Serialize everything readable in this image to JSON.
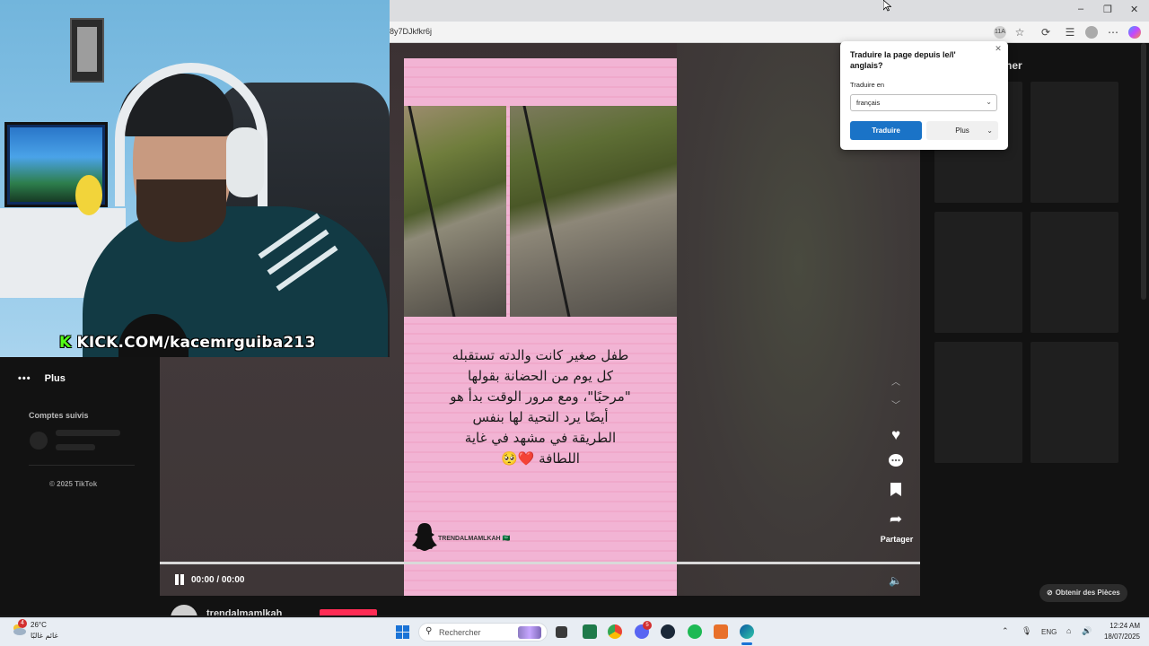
{
  "browser": {
    "url": "8y7DJkfkr6j",
    "window_controls": [
      "–",
      "❐",
      "✕"
    ],
    "reader_badge": "11A"
  },
  "translate_popup": {
    "title": "Traduire la page depuis le/l' anglais?",
    "target_label": "Traduire en",
    "target_value": "français",
    "translate_button": "Traduire",
    "more_button": "Plus"
  },
  "webcam": {
    "overlay_k": "K",
    "overlay_text": "KICK.COM/kacemrguiba213"
  },
  "left_nav": {
    "more_label": "Plus",
    "following_title": "Comptes suivis",
    "copyright": "© 2025 TikTok"
  },
  "video": {
    "caption_lines": [
      "طفل صغير كانت والدته تستقبله",
      "كل يوم من الحضانة بقولها",
      "\"مرحبًا\"، ومع مرور الوقت بدأ هو",
      "أيضًا يرد التحية لها بنفس",
      "الطريقة في مشهد في غاية",
      "اللطافة ❤️🥺"
    ],
    "snap_handle": "TRENDALMAMLKAH 🇸🇦",
    "time": "00:00 / 00:00",
    "progress": 1.0,
    "share_label": "Partager"
  },
  "channel": {
    "name": "trendalmamlkah"
  },
  "recommendations": {
    "title_partial": "ner",
    "coins_button": "Obtenir des Pièces"
  },
  "taskbar": {
    "weather_badge": "4",
    "weather_temp": "26°C",
    "weather_desc": "غائم غالبًا",
    "search_placeholder": "Rechercher",
    "language": "ENG",
    "time": "12:24 AM",
    "date": "18/07/2025",
    "discord_badge": "5"
  },
  "colors": {
    "accent": "#1a73c7",
    "kick_green": "#53fc18",
    "tiktok_red": "#fe2c55",
    "video_pink": "#f2b4d4"
  }
}
